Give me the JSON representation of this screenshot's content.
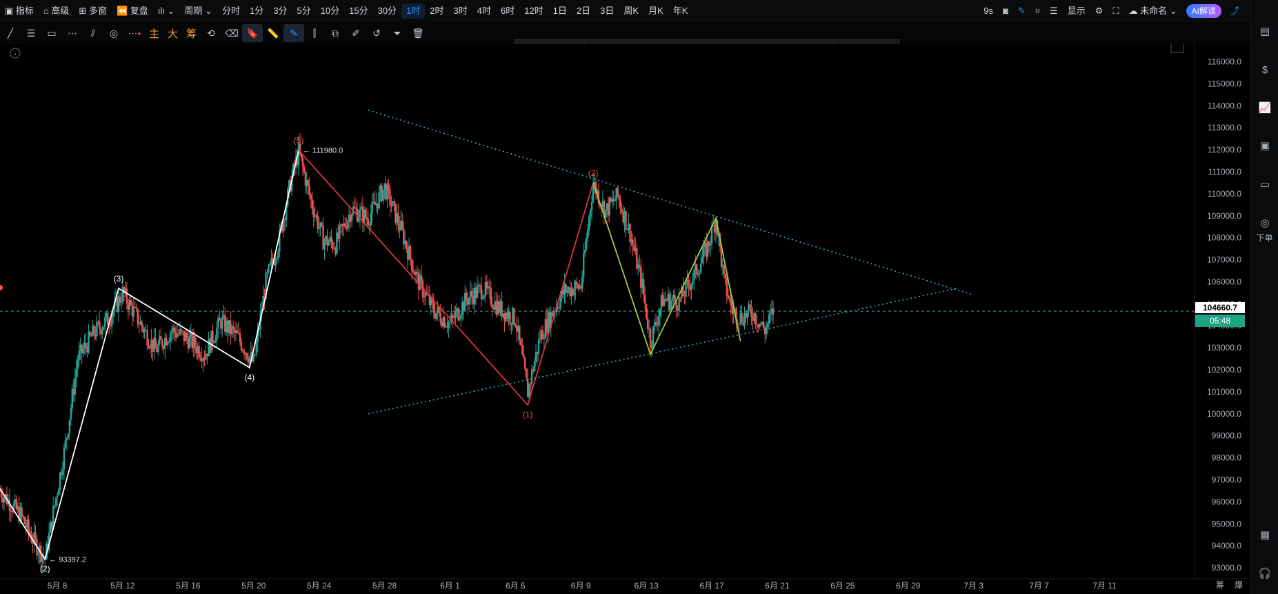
{
  "topbar": {
    "items": [
      "指标",
      "高级",
      "多窗",
      "复盘",
      "",
      "周期",
      "分时",
      "1分",
      "3分",
      "5分",
      "10分",
      "15分",
      "30分",
      "1时",
      "2时",
      "3时",
      "4时",
      "6时",
      "12时",
      "1日",
      "2日",
      "3日",
      "周K",
      "月K",
      "年K"
    ],
    "active_index": 13,
    "right": {
      "seconds": "9s",
      "display": "显示",
      "layout_name": "未命名",
      "ai": "AI解读"
    }
  },
  "toolbar2": {
    "text_buttons": [
      "主",
      "大",
      "筹"
    ]
  },
  "right_rail": {
    "order_label": "下单"
  },
  "status": {
    "bottom_right": [
      "筹",
      "爆"
    ]
  },
  "chart_data": {
    "type": "candlestick",
    "ylim": [
      92500,
      116800
    ],
    "y_ticks": [
      93000,
      94000,
      95000,
      96000,
      97000,
      98000,
      99000,
      100000,
      101000,
      102000,
      103000,
      104000,
      105000,
      106000,
      107000,
      108000,
      109000,
      110000,
      111000,
      112000,
      113000,
      114000,
      115000,
      116000
    ],
    "x_ticks": [
      "5月 8",
      "5月 12",
      "5月 16",
      "5月 20",
      "5月 24",
      "5月 28",
      "6月 1",
      "6月 5",
      "6月 9",
      "6月 13",
      "6月 17",
      "6月 21",
      "6月 25",
      "6月 29",
      "7月 3",
      "7月 7",
      "7月 11"
    ],
    "x_tick_dates": [
      "2025-05-08",
      "2025-05-12",
      "2025-05-16",
      "2025-05-20",
      "2025-05-24",
      "2025-05-28",
      "2025-06-01",
      "2025-06-05",
      "2025-06-09",
      "2025-06-13",
      "2025-06-17",
      "2025-06-21",
      "2025-06-25",
      "2025-06-29",
      "2025-07-03",
      "2025-07-07",
      "2025-07-11"
    ],
    "x_range": [
      "2025-05-04 12:00",
      "2025-07-16 12:00"
    ],
    "current_price": "104660.7",
    "countdown": "05:48",
    "price_annotations": [
      {
        "label": "111980.0",
        "t": "2025-05-22 18:00",
        "price": 111980
      },
      {
        "label": "93397.2",
        "t": "2025-05-07 06:00",
        "price": 93397.2
      }
    ],
    "price_path": [
      [
        "2025-05-04 12:00",
        96500
      ],
      [
        "2025-05-05 18:00",
        95400
      ],
      [
        "2025-05-06 12:00",
        94300
      ],
      [
        "2025-05-07 06:00",
        93397
      ],
      [
        "2025-05-07 18:00",
        95500
      ],
      [
        "2025-05-08 12:00",
        98600
      ],
      [
        "2025-05-09 06:00",
        102500
      ],
      [
        "2025-05-10 06:00",
        103700
      ],
      [
        "2025-05-11 06:00",
        104400
      ],
      [
        "2025-05-12 00:00",
        105500
      ],
      [
        "2025-05-13 00:00",
        104200
      ],
      [
        "2025-05-14 00:00",
        102900
      ],
      [
        "2025-05-15 00:00",
        103800
      ],
      [
        "2025-05-16 00:00",
        103400
      ],
      [
        "2025-05-17 00:00",
        102700
      ],
      [
        "2025-05-18 00:00",
        104200
      ],
      [
        "2025-05-19 00:00",
        103500
      ],
      [
        "2025-05-20 00:00",
        102300
      ],
      [
        "2025-05-20 18:00",
        106000
      ],
      [
        "2025-05-21 12:00",
        107700
      ],
      [
        "2025-05-22 06:00",
        110500
      ],
      [
        "2025-05-22 18:00",
        111900
      ],
      [
        "2025-05-23 12:00",
        109700
      ],
      [
        "2025-05-24 06:00",
        107900
      ],
      [
        "2025-05-25 00:00",
        107700
      ],
      [
        "2025-05-26 00:00",
        109300
      ],
      [
        "2025-05-27 00:00",
        108900
      ],
      [
        "2025-05-28 00:00",
        110300
      ],
      [
        "2025-05-29 00:00",
        108400
      ],
      [
        "2025-05-30 00:00",
        106100
      ],
      [
        "2025-05-31 00:00",
        104700
      ],
      [
        "2025-06-01 00:00",
        104100
      ],
      [
        "2025-06-02 00:00",
        105200
      ],
      [
        "2025-06-03 00:00",
        105700
      ],
      [
        "2025-06-04 00:00",
        104800
      ],
      [
        "2025-06-05 00:00",
        104300
      ],
      [
        "2025-06-05 18:00",
        101000
      ],
      [
        "2025-06-06 12:00",
        103500
      ],
      [
        "2025-06-07 06:00",
        104600
      ],
      [
        "2025-06-08 00:00",
        105600
      ],
      [
        "2025-06-09 00:00",
        105800
      ],
      [
        "2025-06-09 18:00",
        110500
      ],
      [
        "2025-06-10 12:00",
        109200
      ],
      [
        "2025-06-11 06:00",
        109900
      ],
      [
        "2025-06-12 00:00",
        108200
      ],
      [
        "2025-06-12 18:00",
        105800
      ],
      [
        "2025-06-13 06:00",
        103300
      ],
      [
        "2025-06-14 00:00",
        105200
      ],
      [
        "2025-06-15 00:00",
        105100
      ],
      [
        "2025-06-16 00:00",
        106400
      ],
      [
        "2025-06-16 18:00",
        107600
      ],
      [
        "2025-06-17 06:00",
        108900
      ],
      [
        "2025-06-17 18:00",
        106000
      ],
      [
        "2025-06-18 06:00",
        104700
      ],
      [
        "2025-06-18 18:00",
        104400
      ],
      [
        "2025-06-19 12:00",
        104600
      ],
      [
        "2025-06-20 06:00",
        103800
      ],
      [
        "2025-06-20 18:00",
        104660
      ]
    ],
    "waves": [
      {
        "color": "#ffffff",
        "points": [
          [
            "2025-05-04 12:00",
            96600
          ],
          [
            "2025-05-07 06:00",
            93397
          ],
          [
            "2025-05-11 18:00",
            105700
          ],
          [
            "2025-05-19 18:00",
            102100
          ],
          [
            "2025-05-22 18:00",
            111980
          ]
        ]
      },
      {
        "color": "#e2333c",
        "points": [
          [
            "2025-05-22 18:00",
            111980
          ],
          [
            "2025-06-05 18:00",
            100400
          ],
          [
            "2025-06-09 18:00",
            110500
          ]
        ]
      },
      {
        "color": "#9ccf3c",
        "points": [
          [
            "2025-06-09 18:00",
            110500
          ],
          [
            "2025-06-13 06:00",
            102700
          ],
          [
            "2025-06-17 06:00",
            108900
          ],
          [
            "2025-06-18 18:00",
            103300
          ]
        ]
      }
    ],
    "wave_labels": [
      {
        "text": "(2)",
        "t": "2025-05-07 06:00",
        "price": 93397,
        "pos": "below",
        "color": "#ffffff"
      },
      {
        "text": "(3)",
        "t": "2025-05-11 18:00",
        "price": 105700,
        "pos": "above",
        "color": "#ffffff"
      },
      {
        "text": "(4)",
        "t": "2025-05-19 18:00",
        "price": 102100,
        "pos": "below",
        "color": "#ffffff"
      },
      {
        "text": "(5)",
        "t": "2025-05-22 18:00",
        "price": 111980,
        "pos": "above",
        "color": "#ff4d4f"
      },
      {
        "text": "(1)",
        "t": "2025-06-05 18:00",
        "price": 100400,
        "pos": "below",
        "color": "#ff4d4f"
      },
      {
        "text": "(2)",
        "t": "2025-06-09 18:00",
        "price": 110500,
        "pos": "above",
        "color": "#ff4d4f"
      }
    ],
    "trendlines": [
      {
        "color": "#3ab0c0",
        "from": [
          "2025-05-27 00:00",
          113800
        ],
        "to": [
          "2025-07-03 00:00",
          105400
        ]
      },
      {
        "color": "#3ab0c0",
        "from": [
          "2025-05-27 00:00",
          100000
        ],
        "to": [
          "2025-07-02 00:00",
          105700
        ]
      }
    ]
  }
}
